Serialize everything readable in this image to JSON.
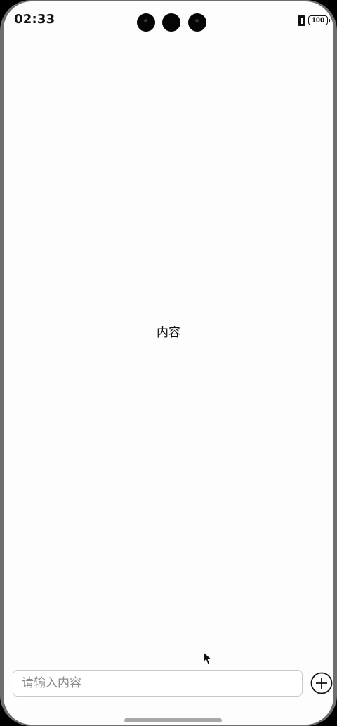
{
  "status_bar": {
    "time": "02:33",
    "battery_level": "100",
    "icons": [
      "alert-icon",
      "battery-icon"
    ]
  },
  "main": {
    "content_text": "内容"
  },
  "input_bar": {
    "placeholder": "请输入内容",
    "value": "",
    "add_icon": "plus-circle-icon"
  }
}
